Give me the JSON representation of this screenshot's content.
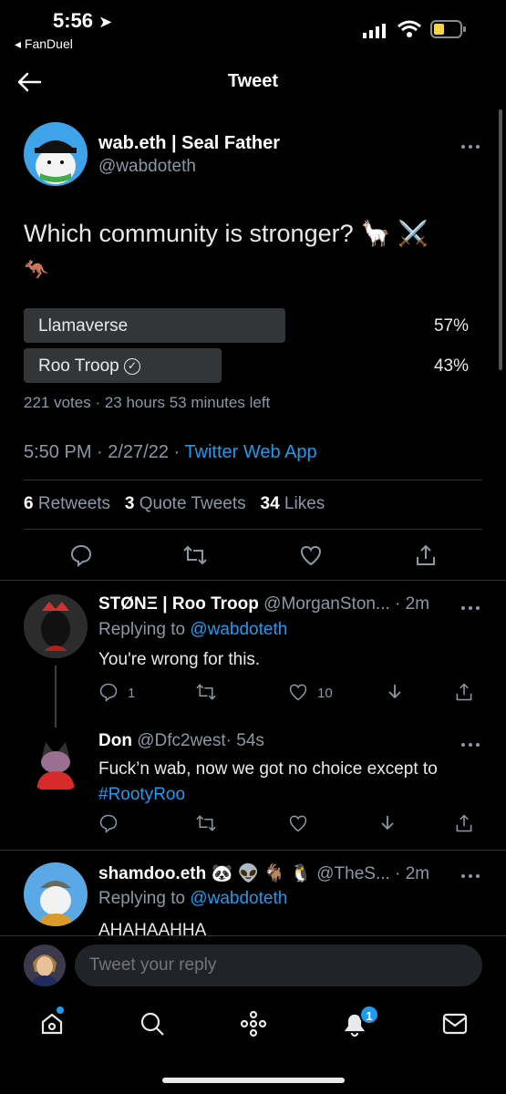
{
  "status_bar": {
    "time": "5:56",
    "back_app": "◂ FanDuel"
  },
  "header": {
    "title": "Tweet"
  },
  "tweet": {
    "author_name": "wab.eth | Seal Father",
    "author_handle": "@wabdoteth",
    "text_line1": "Which community is stronger? 🦙 ⚔️",
    "text_line2": "🦘",
    "poll": {
      "options": [
        {
          "label": "Llamaverse",
          "percent": "57%",
          "value": 57
        },
        {
          "label": "Roo Troop",
          "percent": "43%",
          "value": 43
        }
      ],
      "meta": "221 votes · 23 hours 53 minutes left"
    },
    "time": "5:50 PM · 2/27/22 · ",
    "source": "Twitter Web App",
    "stats": {
      "retweets_count": "6",
      "retweets_label": "Retweets",
      "quotes_count": "3",
      "quotes_label": "Quote Tweets",
      "likes_count": "34",
      "likes_label": "Likes"
    }
  },
  "replies": [
    {
      "name": "STØNΞ | Roo Troop",
      "handle": "@MorganSton...",
      "time": "· 2m",
      "replying_prefix": "Replying to ",
      "replying_to": "@wabdoteth",
      "text": "You're wrong for this.",
      "reply_count": "1",
      "like_count": "10"
    },
    {
      "name": "Don",
      "handle": "@Dfc2west",
      "time": "· 54s",
      "text": "Fuck’n wab, now we got no choice except to",
      "hashtag": "#RootyRoo"
    },
    {
      "name": "shamdoo.eth 🐼 👽 🐐 🐧",
      "handle": "@TheS...",
      "time": "· 2m",
      "replying_prefix": "Replying to ",
      "replying_to": "@wabdoteth",
      "text": "AHAHAAHHA"
    }
  ],
  "compose": {
    "placeholder": "Tweet your reply"
  },
  "tab_bar": {
    "notification_badge": "1"
  },
  "colors": {
    "accent": "#1d9bf0",
    "background": "#000000",
    "poll_bar": "#333639",
    "battery": "#f5d547"
  }
}
